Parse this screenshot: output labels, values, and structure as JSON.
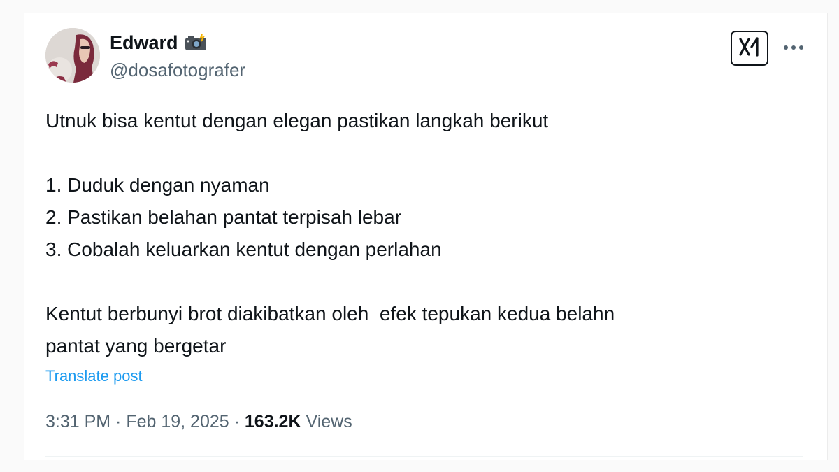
{
  "author": {
    "display_name": "Edward",
    "handle": "@dosafotografer",
    "name_badge_icon": "camera-flash-emoji"
  },
  "header": {
    "grok_button_icon": "grok-x-logo-icon",
    "more_button_icon": "ellipsis-icon"
  },
  "tweet": {
    "lines": [
      "Utnuk bisa kentut dengan elegan pastikan langkah berikut",
      "",
      "1. Duduk dengan nyaman",
      "2. Pastikan belahan pantat terpisah lebar",
      "3. Cobalah keluarkan kentut dengan perlahan",
      "",
      "Kentut berbunyi brot diakibatkan oleh  efek tepukan kedua belahn",
      "pantat yang bergetar"
    ],
    "translate_label": "Translate post"
  },
  "meta": {
    "time": "3:31 PM",
    "separator": " · ",
    "date": "Feb 19, 2025",
    "views_count": "163.2K",
    "views_label": "Views"
  },
  "colors": {
    "text_primary": "#0f1419",
    "text_secondary": "#536471",
    "link": "#1d9bf0"
  }
}
